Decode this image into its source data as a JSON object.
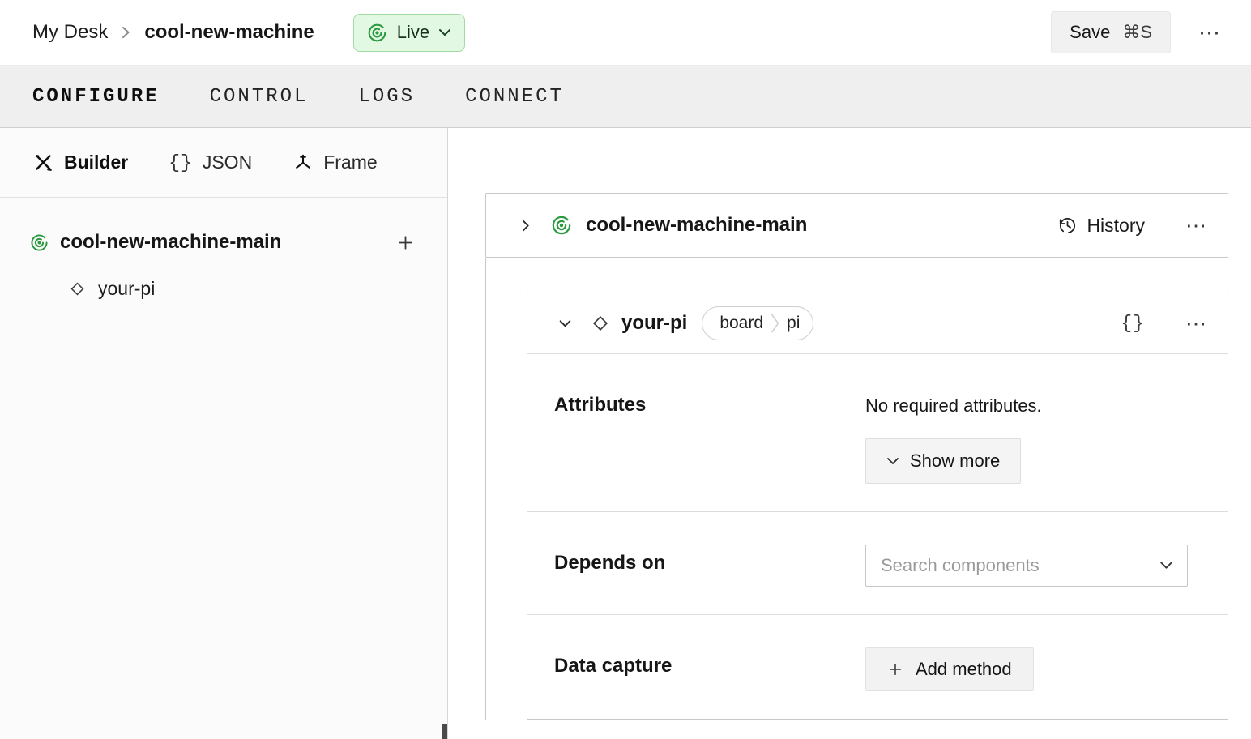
{
  "header": {
    "breadcrumb": {
      "parent": "My Desk",
      "current": "cool-new-machine"
    },
    "live_badge": {
      "label": "Live"
    },
    "save_button": {
      "label": "Save",
      "shortcut": "⌘S"
    }
  },
  "tabs": [
    {
      "label": "CONFIGURE",
      "active": true
    },
    {
      "label": "CONTROL",
      "active": false
    },
    {
      "label": "LOGS",
      "active": false
    },
    {
      "label": "CONNECT",
      "active": false
    }
  ],
  "sidebar": {
    "modes": [
      {
        "label": "Builder",
        "icon": "tools-icon",
        "active": true
      },
      {
        "label": "JSON",
        "icon": "braces-icon",
        "active": false
      },
      {
        "label": "Frame",
        "icon": "frame-axes-icon",
        "active": false
      }
    ],
    "tree": {
      "root_label": "cool-new-machine-main",
      "child_label": "your-pi"
    }
  },
  "main": {
    "machine_card": {
      "title": "cool-new-machine-main",
      "history_label": "History"
    },
    "component_card": {
      "name": "your-pi",
      "type_pill": {
        "type": "board",
        "model": "pi"
      },
      "attributes": {
        "label": "Attributes",
        "empty_text": "No required attributes.",
        "show_more_label": "Show more"
      },
      "depends_on": {
        "label": "Depends on",
        "select_placeholder": "Search components"
      },
      "data_capture": {
        "label": "Data capture",
        "add_method_label": "Add method"
      }
    }
  },
  "glyphs": {
    "ellipsis": "⋯",
    "braces": "{}",
    "plus": "+"
  },
  "colors": {
    "accent_green": "#2b9a3f",
    "live_badge_bg": "#e3f8e3",
    "live_badge_border": "#a3d9a3",
    "tab_bar_bg": "#efefef",
    "card_border": "#c9c9c9"
  }
}
